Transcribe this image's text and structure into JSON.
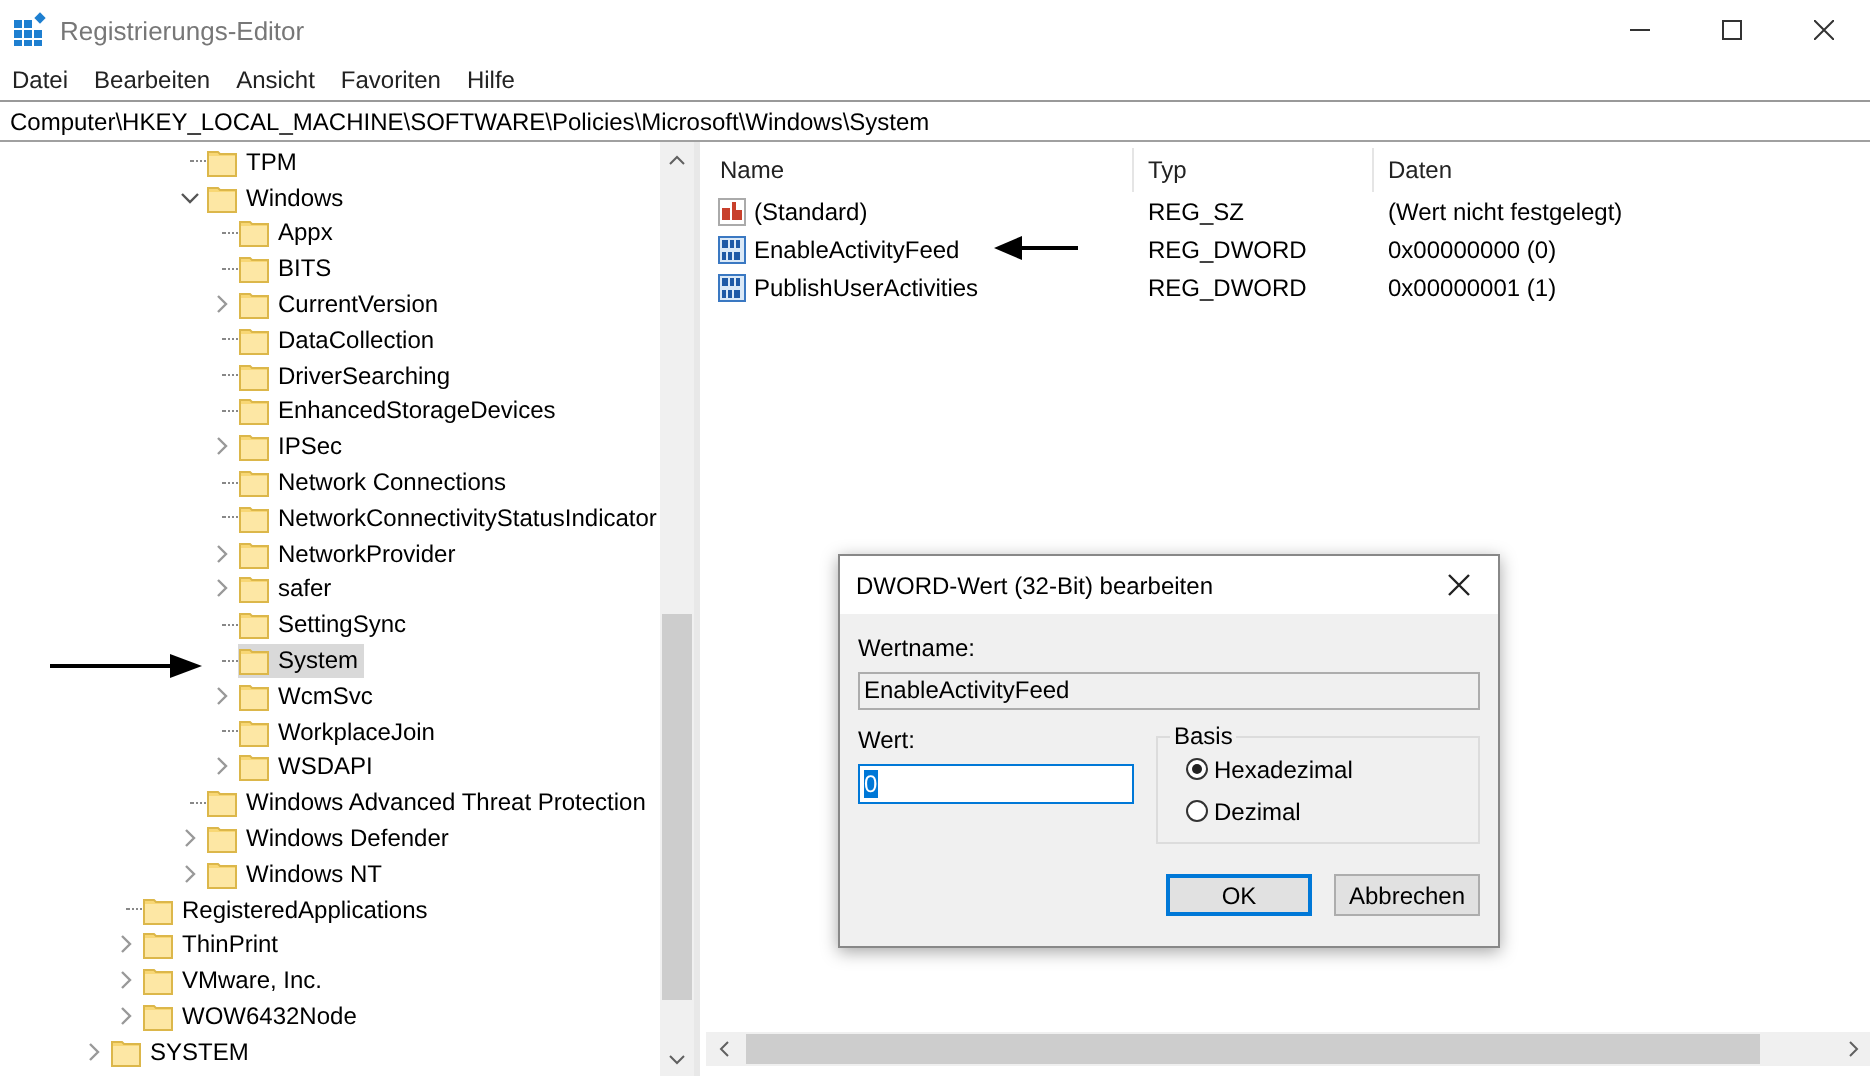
{
  "window": {
    "title": "Registrierungs-Editor"
  },
  "menu": [
    "Datei",
    "Bearbeiten",
    "Ansicht",
    "Favoriten",
    "Hilfe"
  ],
  "address": "Computer\\HKEY_LOCAL_MACHINE\\SOFTWARE\\Policies\\Microsoft\\Windows\\System",
  "tree": {
    "items": [
      {
        "children": [
          {
            "children": [
              {
                "children": [
                  {
                    "label": "TPM",
                    "expandable": false,
                    "expanded": false,
                    "selected": false
                  },
                  {
                    "label": "Windows",
                    "expandable": true,
                    "expanded": true,
                    "selected": false,
                    "children": [
                      {
                        "label": "Appx",
                        "expandable": false,
                        "expanded": false,
                        "selected": false
                      },
                      {
                        "label": "BITS",
                        "expandable": false,
                        "expanded": false,
                        "selected": false
                      },
                      {
                        "label": "CurrentVersion",
                        "expandable": true,
                        "expanded": false,
                        "selected": false
                      },
                      {
                        "label": "DataCollection",
                        "expandable": false,
                        "expanded": false,
                        "selected": false
                      },
                      {
                        "label": "DriverSearching",
                        "expandable": false,
                        "expanded": false,
                        "selected": false
                      },
                      {
                        "label": "EnhancedStorageDevices",
                        "expandable": false,
                        "expanded": false,
                        "selected": false
                      },
                      {
                        "label": "IPSec",
                        "expandable": true,
                        "expanded": false,
                        "selected": false
                      },
                      {
                        "label": "Network Connections",
                        "expandable": false,
                        "expanded": false,
                        "selected": false
                      },
                      {
                        "label": "NetworkConnectivityStatusIndicator",
                        "expandable": false,
                        "expanded": false,
                        "selected": false
                      },
                      {
                        "label": "NetworkProvider",
                        "expandable": true,
                        "expanded": false,
                        "selected": false
                      },
                      {
                        "label": "safer",
                        "expandable": true,
                        "expanded": false,
                        "selected": false
                      },
                      {
                        "label": "SettingSync",
                        "expandable": false,
                        "expanded": false,
                        "selected": false
                      },
                      {
                        "label": "System",
                        "expandable": false,
                        "expanded": false,
                        "selected": true
                      },
                      {
                        "label": "WcmSvc",
                        "expandable": true,
                        "expanded": false,
                        "selected": false
                      },
                      {
                        "label": "WorkplaceJoin",
                        "expandable": false,
                        "expanded": false,
                        "selected": false
                      },
                      {
                        "label": "WSDAPI",
                        "expandable": true,
                        "expanded": false,
                        "selected": false
                      }
                    ]
                  },
                  {
                    "label": "Windows Advanced Threat Protection",
                    "expandable": false,
                    "expanded": false,
                    "selected": false
                  },
                  {
                    "label": "Windows Defender",
                    "expandable": true,
                    "expanded": false,
                    "selected": false
                  },
                  {
                    "label": "Windows NT",
                    "expandable": true,
                    "expanded": false,
                    "selected": false
                  }
                ]
              }
            ]
          },
          {
            "label": "RegisteredApplications",
            "expandable": false,
            "expanded": false,
            "selected": false
          },
          {
            "label": "ThinPrint",
            "expandable": true,
            "expanded": false,
            "selected": false
          },
          {
            "label": "VMware, Inc.",
            "expandable": true,
            "expanded": false,
            "selected": false
          },
          {
            "label": "WOW6432Node",
            "expandable": true,
            "expanded": false,
            "selected": false
          }
        ]
      },
      {
        "label": "SYSTEM",
        "expandable": true,
        "expanded": false,
        "selected": false
      }
    ]
  },
  "values": {
    "columns": [
      "Name",
      "Typ",
      "Daten"
    ],
    "rows": [
      {
        "kind": "string",
        "name": "(Standard)",
        "type": "REG_SZ",
        "data": "(Wert nicht festgelegt)",
        "selected": false
      },
      {
        "kind": "dword",
        "name": "EnableActivityFeed",
        "type": "REG_DWORD",
        "data": "0x00000000 (0)",
        "selected": false
      },
      {
        "kind": "dword",
        "name": "PublishUserActivities",
        "type": "REG_DWORD",
        "data": "0x00000001 (1)",
        "selected": false
      }
    ]
  },
  "dialog": {
    "title": "DWORD-Wert (32-Bit) bearbeiten",
    "name_label": "Wertname:",
    "name_value": "EnableActivityFeed",
    "value_label": "Wert:",
    "value": "0",
    "base_label": "Basis",
    "base_options": [
      {
        "label": "Hexadezimal",
        "selected": true
      },
      {
        "label": "Dezimal",
        "selected": false
      }
    ],
    "buttons": [
      {
        "label": "OK",
        "default": true
      },
      {
        "label": "Abbrechen",
        "default": false
      }
    ]
  }
}
